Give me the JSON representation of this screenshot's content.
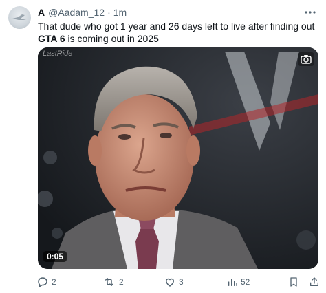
{
  "tweet": {
    "display_name": "A",
    "handle": "@Aadam_12",
    "separator": "·",
    "time": "1m",
    "text_before": "That dude who got 1 year and 26 days left to live after finding out ",
    "text_bold": "GTA 6",
    "text_after": " is coming out in 2025"
  },
  "media": {
    "watermark": "LastRide",
    "duration": "0:05"
  },
  "actions": {
    "replies": "2",
    "reposts": "2",
    "likes": "3",
    "views": "52"
  },
  "icons": {
    "more": "more-icon",
    "camera": "camera-icon",
    "reply": "reply-icon",
    "repost": "repost-icon",
    "like": "heart-icon",
    "views": "views-icon",
    "bookmark": "bookmark-icon",
    "share": "share-icon"
  },
  "colors": {
    "text": "#0f1419",
    "secondary": "#536471"
  }
}
